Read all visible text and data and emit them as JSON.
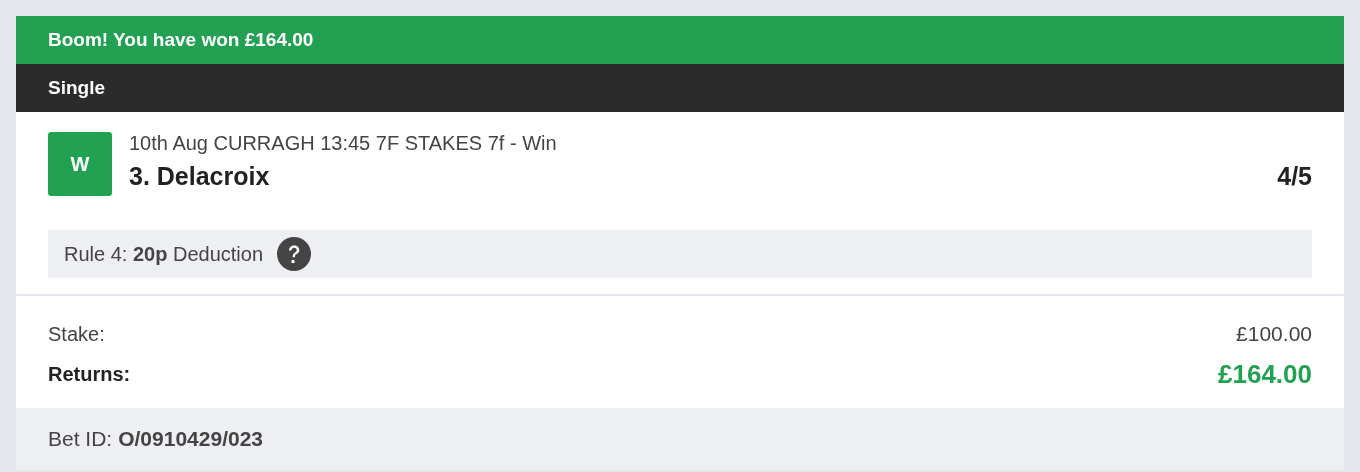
{
  "banner": "Boom! You have won £164.00",
  "bet_type": "Single",
  "selection": {
    "result": "W",
    "event": "10th Aug CURRAGH 13:45 7F STAKES 7f - Win",
    "runner": "3. Delacroix",
    "odds": "4/5"
  },
  "rule4": "Rule 4: **20p** Deduction",
  "stake": {
    "label": "Stake:",
    "value": "£100.00"
  },
  "returns": {
    "label": "Returns:",
    "value": "£164.00"
  },
  "bet_id": {
    "label": "Bet ID:",
    "value": "O/0910429/023"
  }
}
